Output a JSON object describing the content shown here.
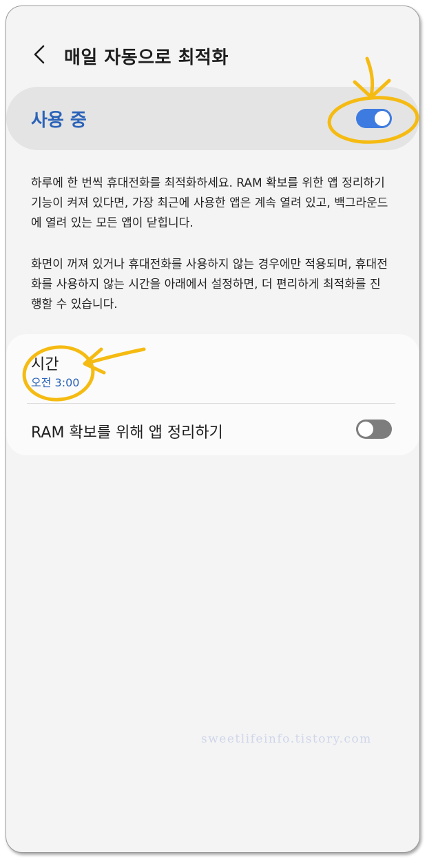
{
  "header": {
    "title": "매일 자동으로 최적화"
  },
  "master_switch": {
    "label": "사용 중",
    "state": "on"
  },
  "description": {
    "paragraph1": "하루에 한 번씩 휴대전화를 최적화하세요. RAM 확보를 위한 앱 정리하기 기능이 켜져 있다면, 가장 최근에 사용한 앱은 계속 열려 있고, 백그라운드에 열려 있는 모든 앱이 닫힙니다.",
    "paragraph2": "화면이 꺼져 있거나 휴대전화를 사용하지 않는 경우에만 적용되며, 휴대전화를 사용하지 않는 시간을 아래에서 설정하면, 더 편리하게 최적화를 진행할 수 있습니다."
  },
  "settings": {
    "time": {
      "title": "시간",
      "value": "오전 3:00"
    },
    "ram_cleanup": {
      "label": "RAM 확보를 위해 앱 정리하기",
      "state": "off"
    }
  },
  "watermark": "sweetlifeinfo.tistory.com",
  "colors": {
    "accent": "#2b63b8",
    "toggle_on": "#3e7be0",
    "toggle_off": "#7d7d7d",
    "annotation": "#f5bb12"
  },
  "icons": {
    "back": "chevron-left-icon"
  }
}
